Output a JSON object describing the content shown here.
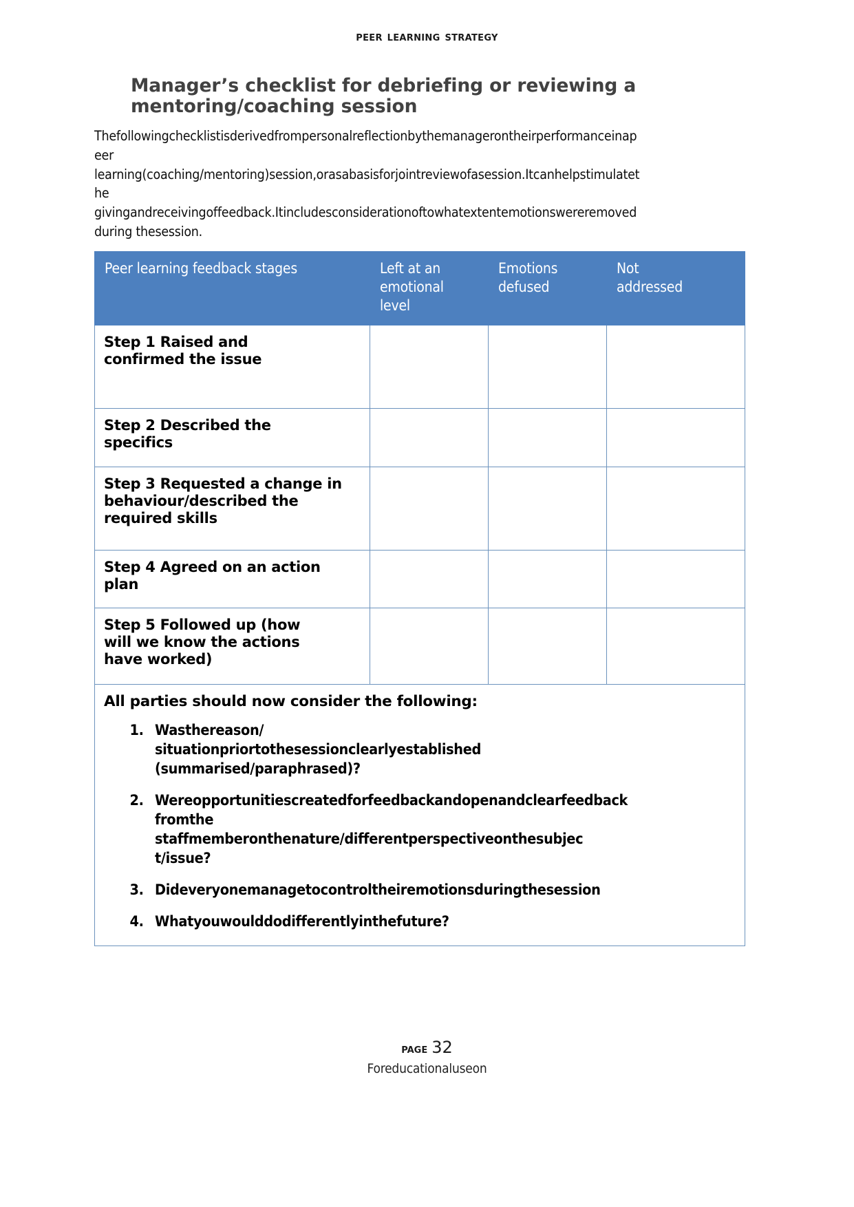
{
  "header": {
    "running_title": "Peer Learning Strategy"
  },
  "title": {
    "line1": "Manager’s checklist for debriefing or reviewing a",
    "line2": "mentoring/coaching session"
  },
  "intro": {
    "line1": "Thefollowingchecklistisderivedfrompersonalreflectionbythemanagerontheirperformanceinap",
    "line2": "eer",
    "line3": "learning(coaching/mentoring)session,orasabasisforjointreviewofasession.Itcanhelpstimulatet",
    "line4": "he",
    "line5": "givingandreceivingoffeedback.Itincludesconsiderationoftowhatextentemotionswereremoved",
    "line6": "during thesession."
  },
  "table": {
    "headers": {
      "col1": "Peer learning feedback stages",
      "col2_line1": "Left at an",
      "col2_line2": "emotional",
      "col2_line3": "level",
      "col3_line1": "Emotions",
      "col3_line2": "defused",
      "col4_line1": "Not",
      "col4_line2": "addressed"
    },
    "rows": [
      {
        "step_line1": "Step 1 Raised and",
        "step_line2": "confirmed the issue",
        "left_at_emotional_level": "",
        "emotions_defused": "",
        "not_addressed": ""
      },
      {
        "step_line1": "Step 2 Described the",
        "step_line2": "specifics",
        "left_at_emotional_level": "",
        "emotions_defused": "",
        "not_addressed": ""
      },
      {
        "step_line1": "Step 3 Requested a change in",
        "step_line2": "behaviour/described the",
        "step_line3": "required skills",
        "left_at_emotional_level": "",
        "emotions_defused": "",
        "not_addressed": ""
      },
      {
        "step_line1": "Step 4 Agreed on an action",
        "step_line2": "plan",
        "left_at_emotional_level": "",
        "emotions_defused": "",
        "not_addressed": ""
      },
      {
        "step_line1": "Step 5 Followed up (how",
        "step_line2": "will we know the actions",
        "step_line3": "have worked)",
        "left_at_emotional_level": "",
        "emotions_defused": "",
        "not_addressed": ""
      }
    ],
    "footer_block": {
      "heading": "All parties should now consider the following:",
      "items": [
        {
          "line1": "Wasthereason/",
          "line2": "situationpriortothesessionclearlyestablished",
          "line3": "(summarised/paraphrased)?"
        },
        {
          "line1": "Wereopportunitiescreatedforfeedbackandopenandclearfeedback",
          "line2": "fromthe",
          "line3": "staffmemberonthenature/differentperspectiveonthesubjec",
          "line4": "t/issue?"
        },
        {
          "line1": "Dideveryonemanagetocontroltheiremotionsduringthesession"
        },
        {
          "line1": "Whatyouwoulddodifferentlyinthefuture?"
        }
      ]
    }
  },
  "footer": {
    "page_word": "Page",
    "page_number": "32",
    "notice": "Foreducationaluseon"
  },
  "colors": {
    "table_header_bg": "#4d80bf",
    "table_border": "#6c93bd",
    "title_text": "#414141",
    "body_text": "#0d0d0d"
  }
}
